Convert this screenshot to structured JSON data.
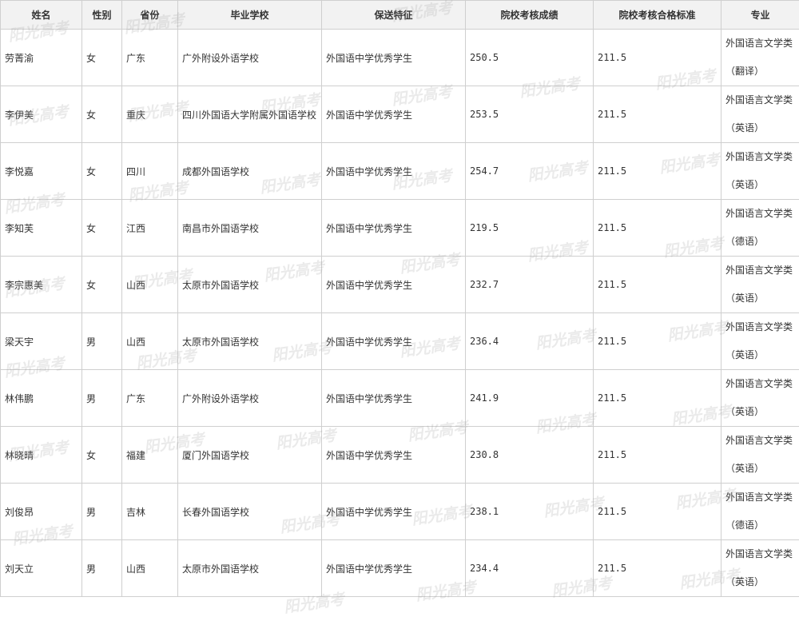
{
  "headers": [
    "姓名",
    "性别",
    "省份",
    "毕业学校",
    "保送特征",
    "院校考核成绩",
    "院校考核合格标准",
    "专业"
  ],
  "rows": [
    {
      "name": "劳菁渝",
      "gender": "女",
      "province": "广东",
      "school": "广外附设外语学校",
      "feature": "外国语中学优秀学生",
      "score": "250.5",
      "standard": "211.5",
      "major": "外国语言文学类",
      "sub": "（翻译）"
    },
    {
      "name": "李伊美",
      "gender": "女",
      "province": "重庆",
      "school": "四川外国语大学附属外国语学校",
      "feature": "外国语中学优秀学生",
      "score": "253.5",
      "standard": "211.5",
      "major": "外国语言文学类",
      "sub": "（英语）"
    },
    {
      "name": "李悦嘉",
      "gender": "女",
      "province": "四川",
      "school": "成都外国语学校",
      "feature": "外国语中学优秀学生",
      "score": "254.7",
      "standard": "211.5",
      "major": "外国语言文学类",
      "sub": "（英语）"
    },
    {
      "name": "李知芙",
      "gender": "女",
      "province": "江西",
      "school": "南昌市外国语学校",
      "feature": "外国语中学优秀学生",
      "score": "219.5",
      "standard": "211.5",
      "major": "外国语言文学类",
      "sub": "（德语）"
    },
    {
      "name": "李宗惠美",
      "gender": "女",
      "province": "山西",
      "school": "太原市外国语学校",
      "feature": "外国语中学优秀学生",
      "score": "232.7",
      "standard": "211.5",
      "major": "外国语言文学类",
      "sub": "（英语）"
    },
    {
      "name": "梁天宇",
      "gender": "男",
      "province": "山西",
      "school": "太原市外国语学校",
      "feature": "外国语中学优秀学生",
      "score": "236.4",
      "standard": "211.5",
      "major": "外国语言文学类",
      "sub": "（英语）"
    },
    {
      "name": "林伟鹏",
      "gender": "男",
      "province": "广东",
      "school": "广外附设外语学校",
      "feature": "外国语中学优秀学生",
      "score": "241.9",
      "standard": "211.5",
      "major": "外国语言文学类",
      "sub": "（英语）"
    },
    {
      "name": "林晓晴",
      "gender": "女",
      "province": "福建",
      "school": "厦门外国语学校",
      "feature": "外国语中学优秀学生",
      "score": "230.8",
      "standard": "211.5",
      "major": "外国语言文学类",
      "sub": "（英语）"
    },
    {
      "name": "刘俊昂",
      "gender": "男",
      "province": "吉林",
      "school": "长春外国语学校",
      "feature": "外国语中学优秀学生",
      "score": "238.1",
      "standard": "211.5",
      "major": "外国语言文学类",
      "sub": "（德语）"
    },
    {
      "name": "刘天立",
      "gender": "男",
      "province": "山西",
      "school": "太原市外国语学校",
      "feature": "外国语中学优秀学生",
      "score": "234.4",
      "standard": "211.5",
      "major": "外国语言文学类",
      "sub": "（英语）"
    }
  ],
  "watermark": {
    "text": "阳光高考"
  }
}
